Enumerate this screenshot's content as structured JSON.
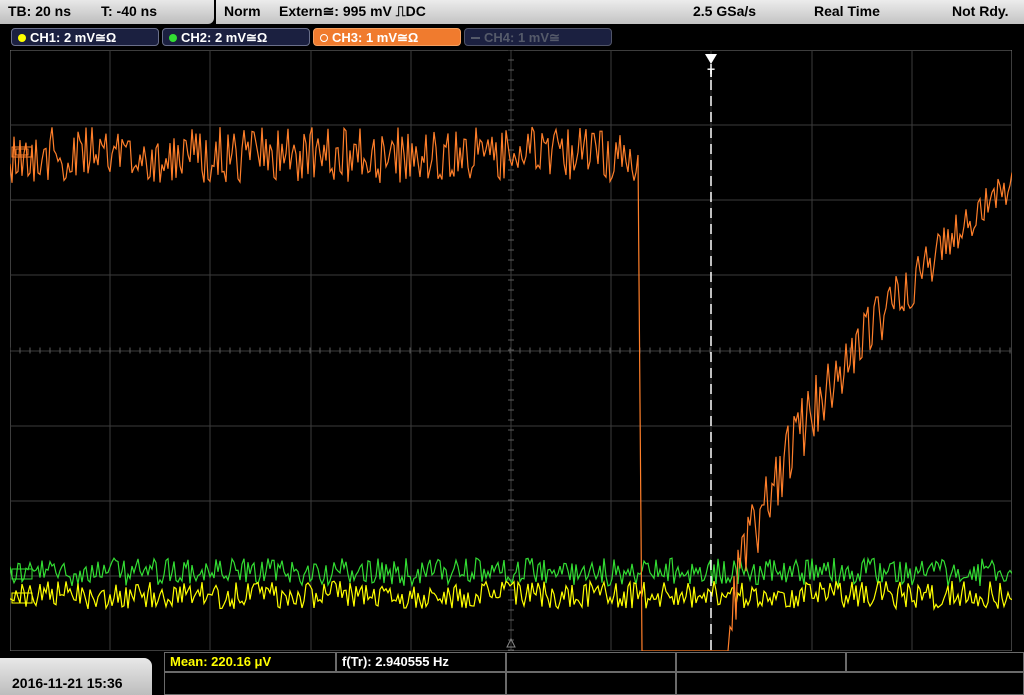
{
  "header": {
    "timebase": "TB: 20 ns",
    "trigger_offset": "T: -40 ns",
    "trigger_mode": "Norm",
    "trigger_source": "Extern≅: 995 mV ⎍DC",
    "sample_rate": "2.5 GSa/s",
    "acq_mode": "Real Time",
    "status": "Not Rdy."
  },
  "channels": [
    {
      "label": "CH1: 2 mV≅Ω",
      "color": "#ffff00",
      "state": "on"
    },
    {
      "label": "CH2: 2 mV≅Ω",
      "color": "#33dd33",
      "state": "on"
    },
    {
      "label": "CH3: 1 mV≅Ω",
      "color": "#ff7f2a",
      "state": "active"
    },
    {
      "label": "CH4: 1 mV≅",
      "color": "#555a6a",
      "state": "off"
    }
  ],
  "trigger_marker": "T",
  "measurements": {
    "mean": "Mean: 220.16 μV",
    "freq": "f(Tr): 2.940555 Hz"
  },
  "datetime": "2016-11-21 15:36",
  "colors": {
    "ch1": "#ffff00",
    "ch2": "#33dd33",
    "ch3": "#ff7f2a",
    "meas_label": "#ffff00"
  }
}
